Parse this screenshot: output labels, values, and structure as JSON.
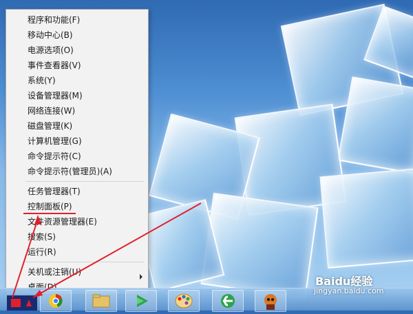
{
  "context_menu": {
    "items": [
      {
        "label": "程序和功能(F)"
      },
      {
        "label": "移动中心(B)"
      },
      {
        "label": "电源选项(O)"
      },
      {
        "label": "事件查看器(V)"
      },
      {
        "label": "系统(Y)"
      },
      {
        "label": "设备管理器(M)"
      },
      {
        "label": "网络连接(W)"
      },
      {
        "label": "磁盘管理(K)"
      },
      {
        "label": "计算机管理(G)"
      },
      {
        "label": "命令提示符(C)"
      },
      {
        "label": "命令提示符(管理员)(A)"
      },
      {
        "label": "任务管理器(T)"
      },
      {
        "label": "控制面板(P)"
      },
      {
        "label": "文件资源管理器(E)"
      },
      {
        "label": "搜索(S)"
      },
      {
        "label": "运行(R)"
      },
      {
        "label": "关机或注销(U)"
      },
      {
        "label": "桌面(D)"
      }
    ]
  },
  "watermark": {
    "brand": "Baidu经验",
    "url": "jingyan.baidu.com"
  },
  "colors": {
    "annotation": "#e0202a",
    "menu_bg": "#f2f2f2"
  },
  "icons": [
    "start-button-icon",
    "chrome-icon",
    "folder-icon",
    "media-player-icon",
    "paint-icon",
    "ie-icon",
    "game-icon"
  ]
}
